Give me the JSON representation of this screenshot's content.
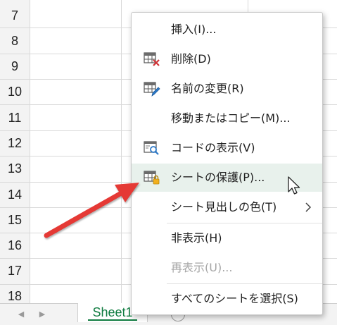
{
  "grid": {
    "row_numbers": [
      "7",
      "8",
      "9",
      "10",
      "11",
      "12",
      "13",
      "14",
      "15",
      "16",
      "17",
      "18"
    ]
  },
  "tabbar": {
    "sheet_tab": "Sheet1"
  },
  "menu": {
    "items": [
      {
        "label": "挿入(I)...",
        "icon": "",
        "enabled": true
      },
      {
        "label": "削除(D)",
        "icon": "delete-sheet-icon",
        "enabled": true
      },
      {
        "label": "名前の変更(R)",
        "icon": "rename-sheet-icon",
        "enabled": true
      },
      {
        "label": "移動またはコピー(M)...",
        "icon": "",
        "enabled": true
      },
      {
        "label": "コードの表示(V)",
        "icon": "view-code-icon",
        "enabled": true
      },
      {
        "label": "シートの保護(P)...",
        "icon": "protect-sheet-icon",
        "enabled": true,
        "highlighted": true
      },
      {
        "label": "シート見出しの色(T)",
        "icon": "",
        "enabled": true,
        "submenu": true
      },
      {
        "label": "非表示(H)",
        "icon": "",
        "enabled": true
      },
      {
        "label": "再表示(U)...",
        "icon": "",
        "enabled": false
      },
      {
        "label": "すべてのシートを選択(S)",
        "icon": "",
        "enabled": true
      }
    ]
  },
  "colors": {
    "accent_green": "#107c41",
    "highlight": "#e8f1ec",
    "annotation_arrow": "#e53935"
  }
}
